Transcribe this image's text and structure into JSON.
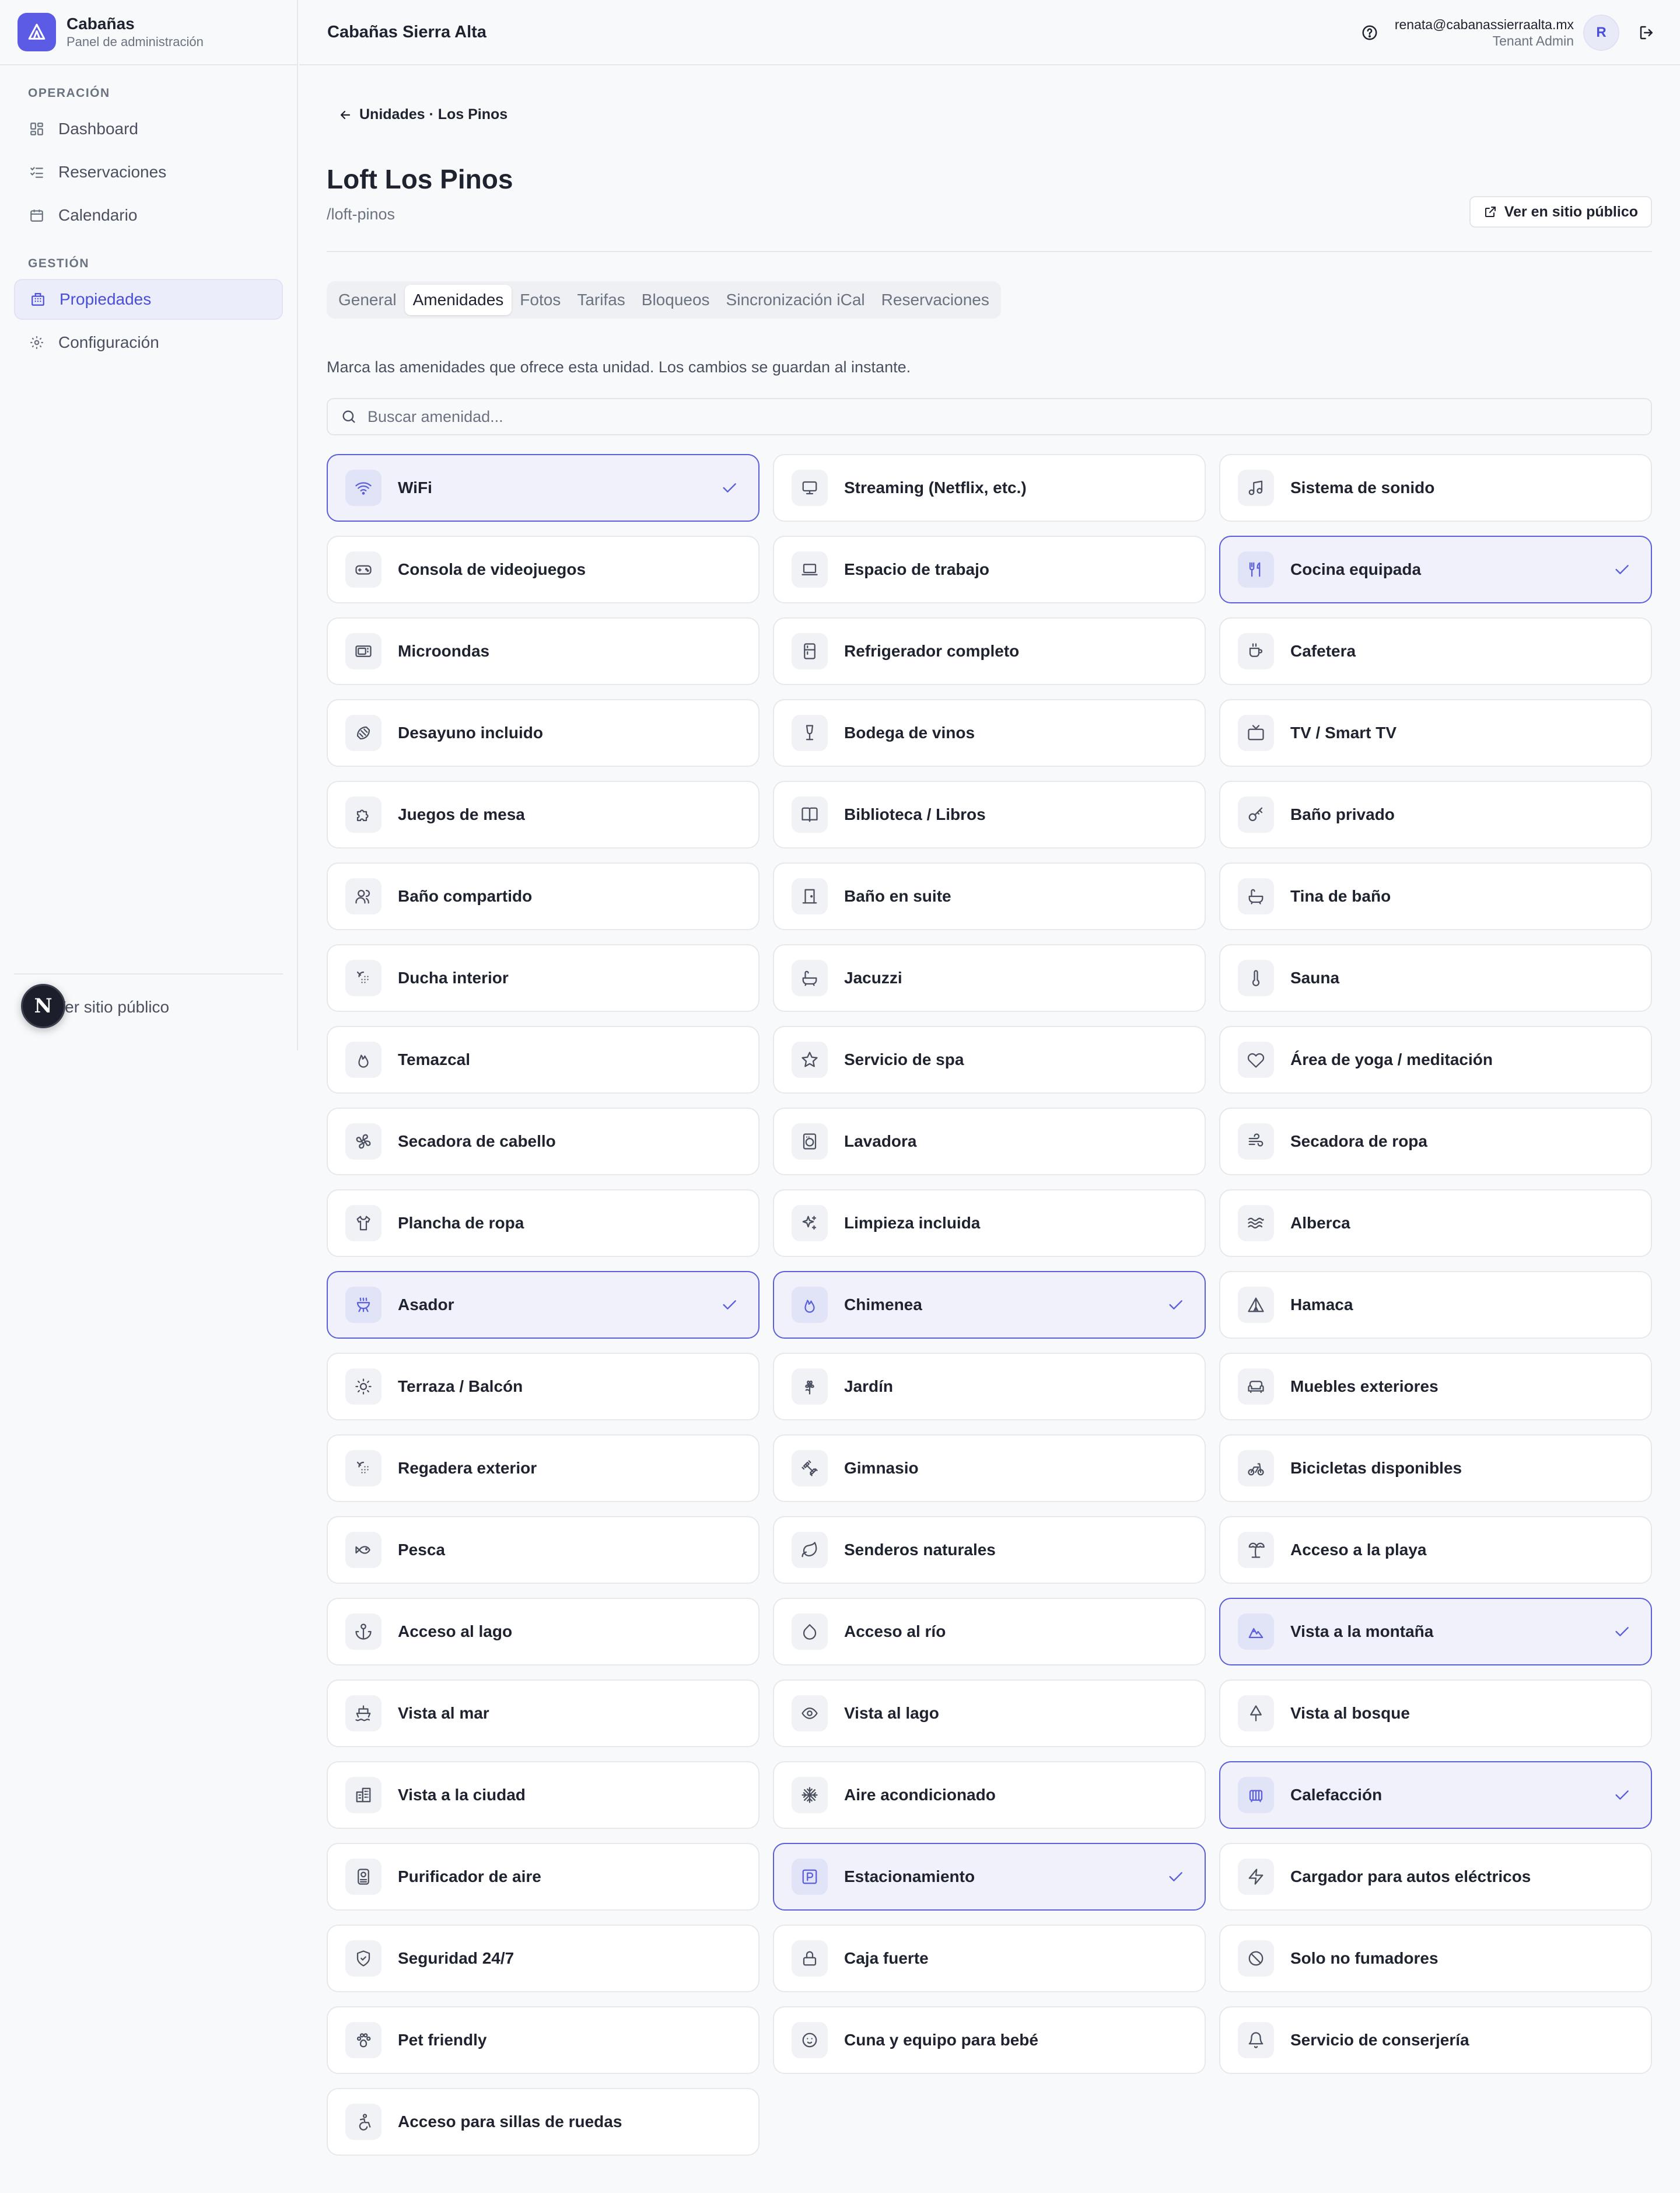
{
  "brand": {
    "name": "Cabañas",
    "subtitle": "Panel de administración"
  },
  "sidebar": {
    "sections": [
      {
        "title": "OPERACIÓN"
      },
      {
        "title": "GESTIÓN"
      }
    ],
    "items": [
      {
        "label": "Dashboard",
        "icon": "dashboard-icon"
      },
      {
        "label": "Reservaciones",
        "icon": "list-check-icon"
      },
      {
        "label": "Calendario",
        "icon": "calendar-icon"
      },
      {
        "label": "Propiedades",
        "icon": "building-icon",
        "active": true
      },
      {
        "label": "Configuración",
        "icon": "gear-icon"
      }
    ],
    "footer_link": "Ver sitio público",
    "badge": "N"
  },
  "header": {
    "tenant": "Cabañas Sierra Alta",
    "user_email": "renata@cabanassierraalta.mx",
    "user_role": "Tenant Admin",
    "avatar_initial": "R"
  },
  "page": {
    "breadcrumb": "Unidades · Los Pinos",
    "title": "Loft Los Pinos",
    "slug": "/loft-pinos",
    "public_button": "Ver en sitio público",
    "tabs": [
      {
        "label": "General"
      },
      {
        "label": "Amenidades",
        "active": true
      },
      {
        "label": "Fotos"
      },
      {
        "label": "Tarifas"
      },
      {
        "label": "Bloqueos"
      },
      {
        "label": "Sincronización iCal"
      },
      {
        "label": "Reservaciones"
      }
    ],
    "hint": "Marca las amenidades que ofrece esta unidad. Los cambios se guardan al instante.",
    "search_placeholder": "Buscar amenidad..."
  },
  "colors": {
    "accent": "#5b5fd9",
    "selected_bg": "#f0f1fb"
  },
  "amenities": [
    {
      "label": "WiFi",
      "icon": "wifi-icon",
      "selected": true
    },
    {
      "label": "Streaming (Netflix, etc.)",
      "icon": "monitor-icon",
      "selected": false
    },
    {
      "label": "Sistema de sonido",
      "icon": "music-icon",
      "selected": false
    },
    {
      "label": "Consola de videojuegos",
      "icon": "gamepad-icon",
      "selected": false
    },
    {
      "label": "Espacio de trabajo",
      "icon": "laptop-icon",
      "selected": false
    },
    {
      "label": "Cocina equipada",
      "icon": "utensils-icon",
      "selected": true
    },
    {
      "label": "Microondas",
      "icon": "microwave-icon",
      "selected": false
    },
    {
      "label": "Refrigerador completo",
      "icon": "fridge-icon",
      "selected": false
    },
    {
      "label": "Cafetera",
      "icon": "coffee-icon",
      "selected": false
    },
    {
      "label": "Desayuno incluido",
      "icon": "croissant-icon",
      "selected": false
    },
    {
      "label": "Bodega de vinos",
      "icon": "wine-icon",
      "selected": false
    },
    {
      "label": "TV / Smart TV",
      "icon": "tv-icon",
      "selected": false
    },
    {
      "label": "Juegos de mesa",
      "icon": "puzzle-icon",
      "selected": false
    },
    {
      "label": "Biblioteca / Libros",
      "icon": "book-icon",
      "selected": false
    },
    {
      "label": "Baño privado",
      "icon": "key-icon",
      "selected": false
    },
    {
      "label": "Baño compartido",
      "icon": "users-icon",
      "selected": false
    },
    {
      "label": "Baño en suite",
      "icon": "door-icon",
      "selected": false
    },
    {
      "label": "Tina de baño",
      "icon": "bath-icon",
      "selected": false
    },
    {
      "label": "Ducha interior",
      "icon": "shower-icon",
      "selected": false
    },
    {
      "label": "Jacuzzi",
      "icon": "bath-icon",
      "selected": false
    },
    {
      "label": "Sauna",
      "icon": "thermometer-icon",
      "selected": false
    },
    {
      "label": "Temazcal",
      "icon": "flame-icon",
      "selected": false
    },
    {
      "label": "Servicio de spa",
      "icon": "star-icon",
      "selected": false
    },
    {
      "label": "Área de yoga / meditación",
      "icon": "heart-icon",
      "selected": false
    },
    {
      "label": "Secadora de cabello",
      "icon": "fan-icon",
      "selected": false
    },
    {
      "label": "Lavadora",
      "icon": "washer-icon",
      "selected": false
    },
    {
      "label": "Secadora de ropa",
      "icon": "wind-icon",
      "selected": false
    },
    {
      "label": "Plancha de ropa",
      "icon": "shirt-icon",
      "selected": false
    },
    {
      "label": "Limpieza incluida",
      "icon": "sparkles-icon",
      "selected": false
    },
    {
      "label": "Alberca",
      "icon": "waves-icon",
      "selected": false
    },
    {
      "label": "Asador",
      "icon": "grill-icon",
      "selected": true
    },
    {
      "label": "Chimenea",
      "icon": "flame-icon",
      "selected": true
    },
    {
      "label": "Hamaca",
      "icon": "tent-icon",
      "selected": false
    },
    {
      "label": "Terraza / Balcón",
      "icon": "sun-icon",
      "selected": false
    },
    {
      "label": "Jardín",
      "icon": "flower-icon",
      "selected": false
    },
    {
      "label": "Muebles exteriores",
      "icon": "sofa-icon",
      "selected": false
    },
    {
      "label": "Regadera exterior",
      "icon": "shower-icon",
      "selected": false
    },
    {
      "label": "Gimnasio",
      "icon": "dumbbell-icon",
      "selected": false
    },
    {
      "label": "Bicicletas disponibles",
      "icon": "bike-icon",
      "selected": false
    },
    {
      "label": "Pesca",
      "icon": "fish-icon",
      "selected": false
    },
    {
      "label": "Senderos naturales",
      "icon": "leaf-icon",
      "selected": false
    },
    {
      "label": "Acceso a la playa",
      "icon": "palm-icon",
      "selected": false
    },
    {
      "label": "Acceso al lago",
      "icon": "anchor-icon",
      "selected": false
    },
    {
      "label": "Acceso al río",
      "icon": "droplet-icon",
      "selected": false
    },
    {
      "label": "Vista a la montaña",
      "icon": "mountain-icon",
      "selected": true
    },
    {
      "label": "Vista al mar",
      "icon": "ship-icon",
      "selected": false
    },
    {
      "label": "Vista al lago",
      "icon": "eye-icon",
      "selected": false
    },
    {
      "label": "Vista al bosque",
      "icon": "tree-icon",
      "selected": false
    },
    {
      "label": "Vista a la ciudad",
      "icon": "city-icon",
      "selected": false
    },
    {
      "label": "Aire acondicionado",
      "icon": "snowflake-icon",
      "selected": false
    },
    {
      "label": "Calefacción",
      "icon": "heater-icon",
      "selected": true
    },
    {
      "label": "Purificador de aire",
      "icon": "purifier-icon",
      "selected": false
    },
    {
      "label": "Estacionamiento",
      "icon": "parking-icon",
      "selected": true
    },
    {
      "label": "Cargador para autos eléctricos",
      "icon": "bolt-icon",
      "selected": false
    },
    {
      "label": "Seguridad 24/7",
      "icon": "shield-icon",
      "selected": false
    },
    {
      "label": "Caja fuerte",
      "icon": "lock-icon",
      "selected": false
    },
    {
      "label": "Solo no fumadores",
      "icon": "ban-icon",
      "selected": false
    },
    {
      "label": "Pet friendly",
      "icon": "paw-icon",
      "selected": false
    },
    {
      "label": "Cuna y equipo para bebé",
      "icon": "baby-icon",
      "selected": false
    },
    {
      "label": "Servicio de conserjería",
      "icon": "bell-icon",
      "selected": false
    },
    {
      "label": "Acceso para sillas de ruedas",
      "icon": "accessibility-icon",
      "selected": false
    }
  ]
}
